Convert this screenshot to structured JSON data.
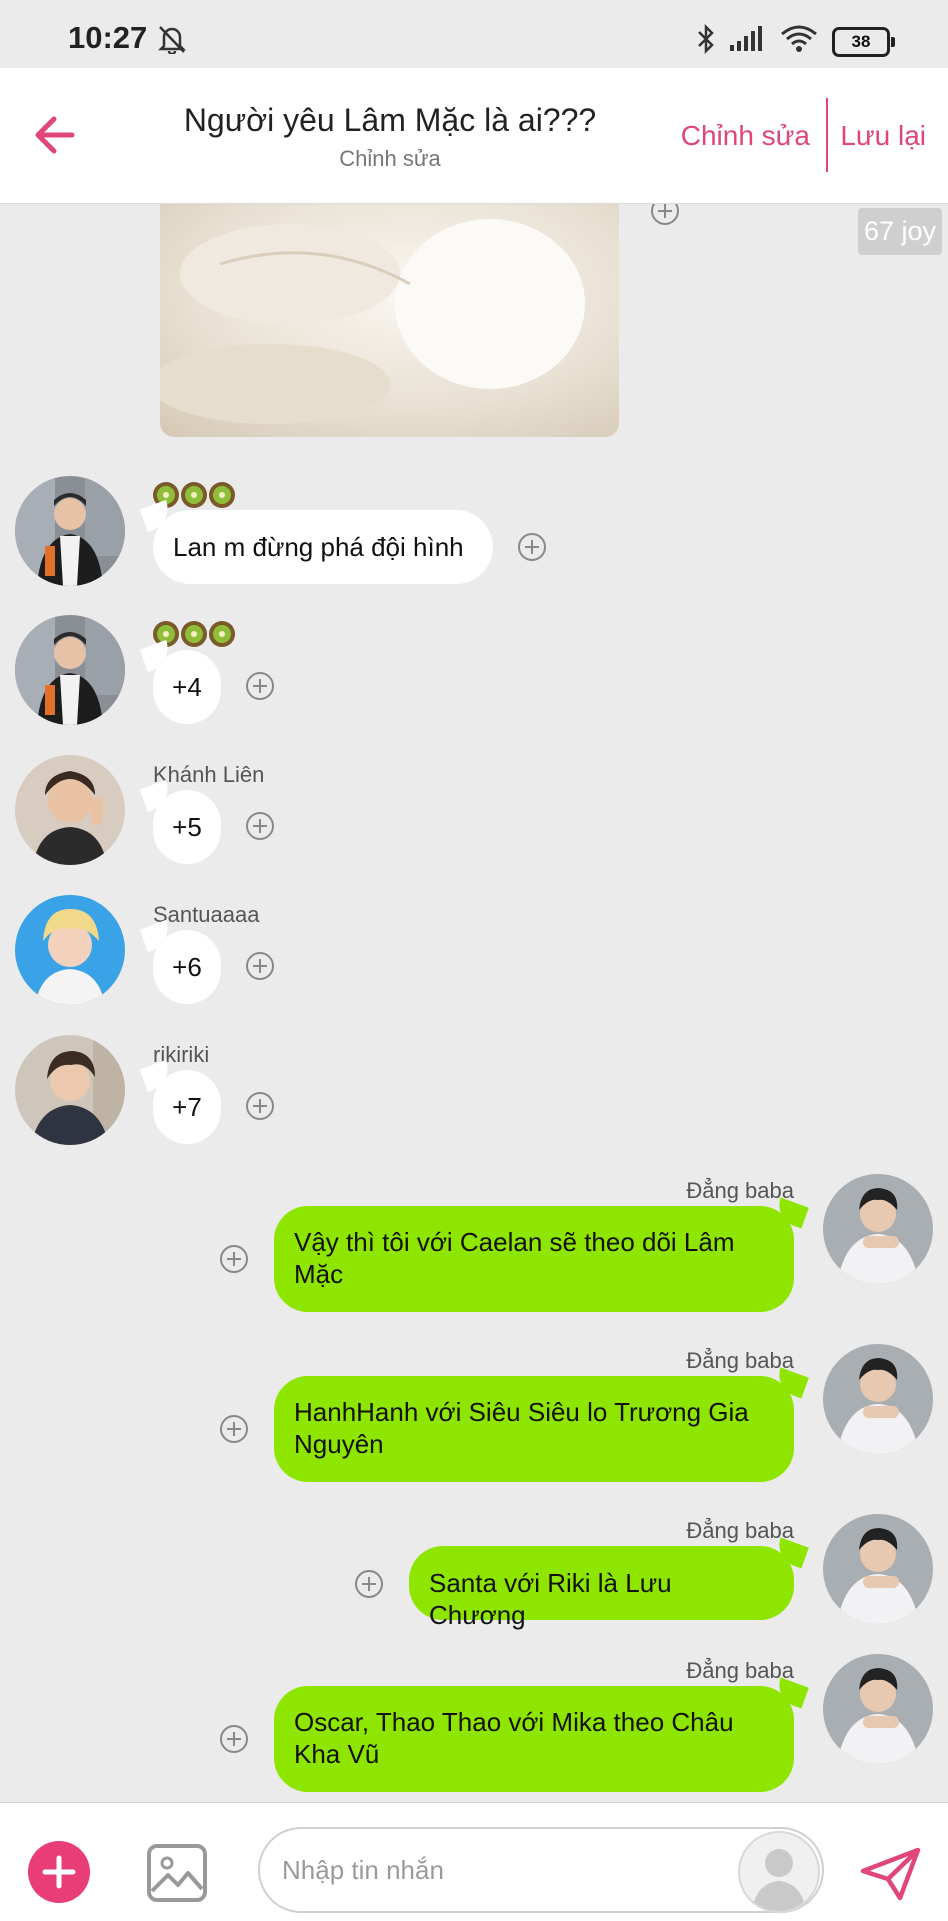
{
  "status_bar": {
    "time": "10:27",
    "battery": "38"
  },
  "header": {
    "title": "Người yêu Lâm Mặc là ai???",
    "subtitle": "Chỉnh sửa",
    "edit_label": "Chỉnh sửa",
    "save_label": "Lưu lại"
  },
  "image_post": {
    "joy": "67 joy"
  },
  "messages": [
    {
      "sender": "",
      "text": "Lan m đừng phá đội hình"
    },
    {
      "sender": "",
      "text": "+4"
    },
    {
      "sender": "Khánh Liên",
      "text": "+5"
    },
    {
      "sender": "Santuaaaa",
      "text": "+6"
    },
    {
      "sender": "rikiriki",
      "text": "+7"
    },
    {
      "sender": "Đẳng baba",
      "text": "Vậy thì tôi với Caelan sẽ theo dõi Lâm Mặc"
    },
    {
      "sender": "Đẳng baba",
      "text": "HanhHanh với Siêu Siêu lo Trương Gia Nguyên"
    },
    {
      "sender": "Đẳng baba",
      "text": "Santa với Riki là Lưu Chương"
    },
    {
      "sender": "Đẳng baba",
      "text": "Oscar, Thao Thao với Mika theo Châu Kha Vũ"
    }
  ],
  "composer": {
    "placeholder": "Nhập tin nhắn"
  },
  "colors": {
    "accent": "#e0457b",
    "own_bubble": "#8ee600"
  }
}
